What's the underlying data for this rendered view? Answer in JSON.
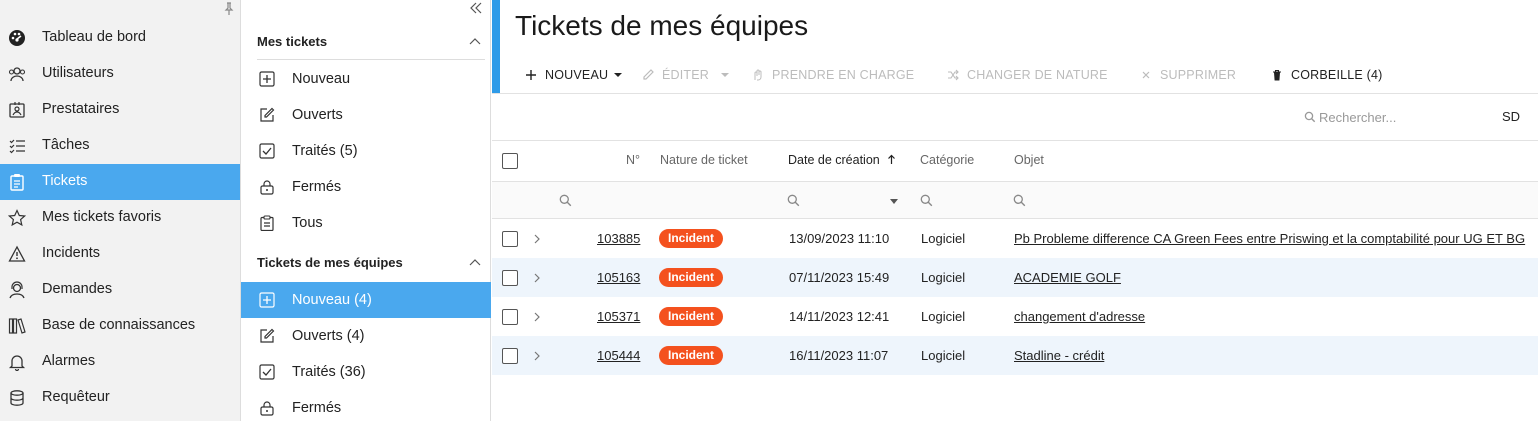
{
  "nav": {
    "items": [
      {
        "label": "Tableau de bord",
        "icon": "dashboard-icon"
      },
      {
        "label": "Utilisateurs",
        "icon": "users-icon"
      },
      {
        "label": "Prestataires",
        "icon": "contact-card-icon"
      },
      {
        "label": "Tâches",
        "icon": "task-list-icon"
      },
      {
        "label": "Tickets",
        "icon": "clipboard-icon",
        "active": true
      },
      {
        "label": "Mes tickets favoris",
        "icon": "star-icon"
      },
      {
        "label": "Incidents",
        "icon": "warning-icon"
      },
      {
        "label": "Demandes",
        "icon": "support-agent-icon"
      },
      {
        "label": "Base de connaissances",
        "icon": "books-icon"
      },
      {
        "label": "Alarmes",
        "icon": "bell-icon"
      },
      {
        "label": "Requêteur",
        "icon": "database-icon"
      }
    ]
  },
  "mid": {
    "section1": {
      "title": "Mes tickets",
      "items": [
        {
          "label": "Nouveau",
          "icon": "plus-box-icon"
        },
        {
          "label": "Ouverts",
          "icon": "edit-icon"
        },
        {
          "label": "Traités (5)",
          "icon": "check-box-icon"
        },
        {
          "label": "Fermés",
          "icon": "lock-icon"
        },
        {
          "label": "Tous",
          "icon": "clipboard-icon"
        }
      ]
    },
    "section2": {
      "title": "Tickets de mes équipes",
      "items": [
        {
          "label": "Nouveau (4)",
          "icon": "plus-box-icon",
          "active": true
        },
        {
          "label": "Ouverts (4)",
          "icon": "edit-icon"
        },
        {
          "label": "Traités (36)",
          "icon": "check-box-icon"
        },
        {
          "label": "Fermés",
          "icon": "lock-icon"
        }
      ]
    }
  },
  "main": {
    "title": "Tickets de mes équipes",
    "toolbar": {
      "new": "NOUVEAU",
      "edit": "ÉDITER",
      "take": "PRENDRE EN CHARGE",
      "change": "CHANGER DE NATURE",
      "delete": "SUPPRIMER",
      "trash": "CORBEILLE (4)"
    },
    "search": {
      "placeholder": "Rechercher..."
    },
    "user_initials": "SD",
    "columns": {
      "num": "N°",
      "nature": "Nature de ticket",
      "date": "Date de création",
      "category": "Catégorie",
      "object": "Objet"
    },
    "rows": [
      {
        "num": "103885",
        "nature": "Incident",
        "date": "13/09/2023 11:10",
        "category": "Logiciel",
        "object": "Pb Probleme difference CA Green Fees entre Priswing et la comptabilité pour UG ET BG"
      },
      {
        "num": "105163",
        "nature": "Incident",
        "date": "07/11/2023 15:49",
        "category": "Logiciel",
        "object": "ACADEMIE GOLF"
      },
      {
        "num": "105371",
        "nature": "Incident",
        "date": "14/11/2023 12:41",
        "category": "Logiciel",
        "object": "changement d'adresse"
      },
      {
        "num": "105444",
        "nature": "Incident",
        "date": "16/11/2023 11:07",
        "category": "Logiciel",
        "object": "Stadline - crédit"
      }
    ],
    "colors": {
      "accent": "#2f9be8",
      "active": "#4aa8ee",
      "badge": "#f4511e",
      "alt_row": "#eef5fc"
    }
  }
}
